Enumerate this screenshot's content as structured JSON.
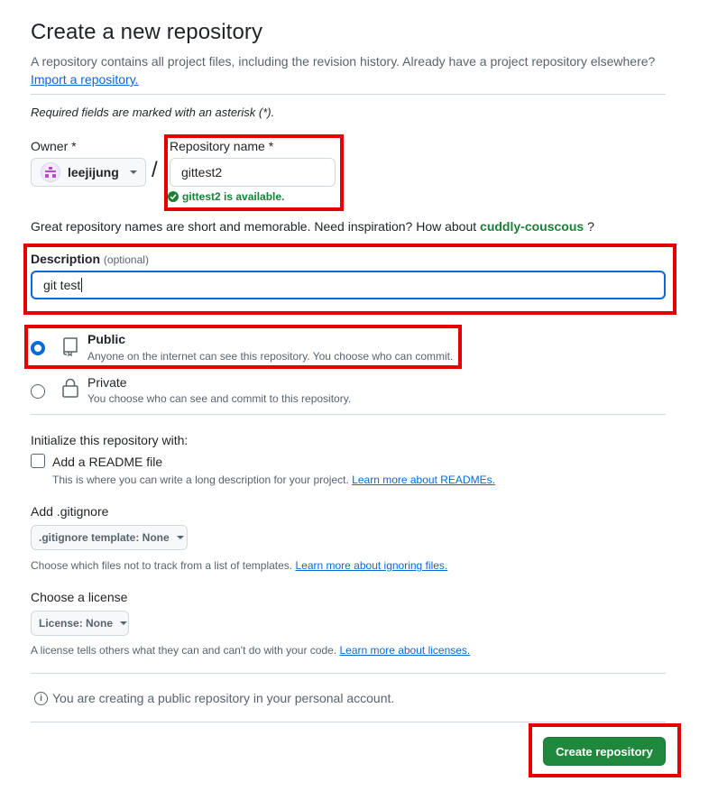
{
  "header": {
    "title": "Create a new repository",
    "subtitle": "A repository contains all project files, including the revision history. Already have a project repository elsewhere?",
    "import_link": "Import a repository."
  },
  "required_note": "Required fields are marked with an asterisk (*).",
  "owner": {
    "label": "Owner *",
    "value": "leejijung"
  },
  "separator": "/",
  "repo_name": {
    "label": "Repository name *",
    "value": "gittest2",
    "availability": "gittest2 is available."
  },
  "name_hint": {
    "text": "Great repository names are short and memorable. Need inspiration? How about",
    "suggestion": "cuddly-couscous",
    "end": "?"
  },
  "description": {
    "label": "Description",
    "optional": "(optional)",
    "value": "git test"
  },
  "visibility": {
    "public": {
      "title": "Public",
      "desc": "Anyone on the internet can see this repository. You choose who can commit.",
      "checked": true
    },
    "private": {
      "title": "Private",
      "desc": "You choose who can see and commit to this repository.",
      "checked": false
    }
  },
  "initialize": {
    "heading": "Initialize this repository with:",
    "readme_label": "Add a README file",
    "readme_desc": "This is where you can write a long description for your project.",
    "readme_link": "Learn more about READMEs."
  },
  "gitignore": {
    "heading": "Add .gitignore",
    "select": ".gitignore template: None",
    "desc": "Choose which files not to track from a list of templates.",
    "link": "Learn more about ignoring files."
  },
  "license": {
    "heading": "Choose a license",
    "select": "License: None",
    "desc": "A license tells others what they can and can't do with your code.",
    "link": "Learn more about licenses."
  },
  "info_text": "You are creating a public repository in your personal account.",
  "create_button": "Create repository",
  "colors": {
    "primary_green": "#1f883d",
    "link_blue": "#0969da",
    "success_green": "#1a7f37",
    "highlight_red": "#e50000"
  }
}
